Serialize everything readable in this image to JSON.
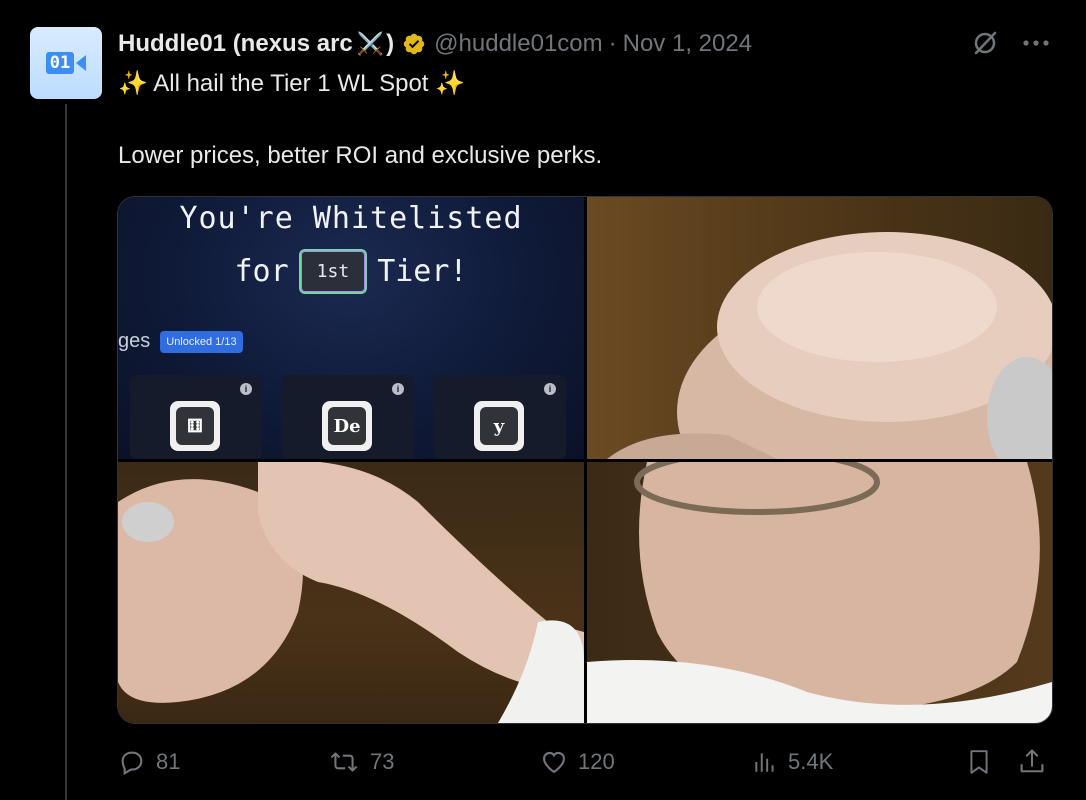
{
  "author": {
    "name": "Huddle01 (nexus arc",
    "name_emoji": "⚔️",
    "name_suffix": ")",
    "handle": "@huddle01com",
    "separator": "·",
    "date": "Nov 1, 2024",
    "avatar_text": "01"
  },
  "tweet": {
    "line1_prefix": "✨",
    "line1": "All hail the Tier 1 WL Spot",
    "line1_suffix": "✨",
    "line2": "Lower prices, better ROI and exclusive perks."
  },
  "media": {
    "title": "You're Whitelisted",
    "for_text": "for",
    "tier_pill": "1st",
    "tier_text": "Tier!",
    "badges_label": "ges",
    "unlocked_label": "Unlocked 1/13",
    "badge_cards": [
      {
        "tile": "⚅",
        "icon": "document-badge"
      },
      {
        "tile": "De",
        "icon": "de-badge"
      },
      {
        "tile": "y",
        "icon": "y-badge"
      }
    ],
    "info_glyph": "i"
  },
  "actions": {
    "replies": "81",
    "reposts": "73",
    "likes": "120",
    "views": "5.4K"
  },
  "colors": {
    "background": "#000000",
    "text_primary": "#e7e9ea",
    "text_secondary": "#71767b",
    "verified_gold": "#e2b719",
    "unlocked_blue": "#2f6de0"
  }
}
